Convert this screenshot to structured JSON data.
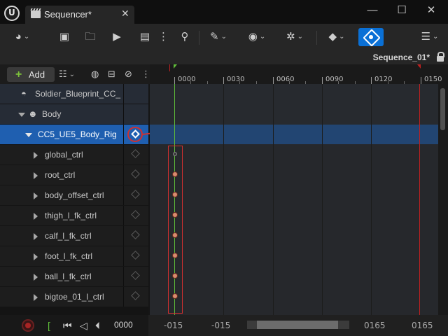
{
  "titlebar": {
    "tab_label": "Sequencer*",
    "close_glyph": "✕",
    "minimize_glyph": "—",
    "maximize_glyph": "☐",
    "window_close_glyph": "✕"
  },
  "toolbar": {
    "icons": [
      "world-icon",
      "save-icon",
      "browse-icon",
      "camera-icon",
      "clapper-icon",
      "more-icon",
      "actor-icon",
      "wrench-icon",
      "eye-icon",
      "gear-icon",
      "keyframe-icon",
      "curve-editor-icon",
      "menu-icon"
    ],
    "accent_color": "#0a70d6"
  },
  "sequence": {
    "name": "Sequence_01*"
  },
  "outliner": {
    "add_label": "Add",
    "rows": [
      {
        "label": "Soldier_Blueprint_CC_"
      },
      {
        "label": "Body"
      },
      {
        "label": "CC5_UE5_Body_Rig"
      },
      {
        "label": "global_ctrl"
      },
      {
        "label": "root_ctrl"
      },
      {
        "label": "body_offset_ctrl"
      },
      {
        "label": "thigh_l_fk_ctrl"
      },
      {
        "label": "calf_l_fk_ctrl"
      },
      {
        "label": "foot_l_fk_ctrl"
      },
      {
        "label": "ball_l_fk_ctrl"
      },
      {
        "label": "bigtoe_01_l_ctrl"
      }
    ]
  },
  "ruler": {
    "ticks": [
      "0000",
      "0030",
      "0060",
      "0090",
      "0120",
      "0150"
    ]
  },
  "bottom": {
    "current_frame": "0000",
    "view_start": "-015",
    "view_start_2": "-015",
    "view_end": "0165",
    "view_end_2": "0165"
  }
}
